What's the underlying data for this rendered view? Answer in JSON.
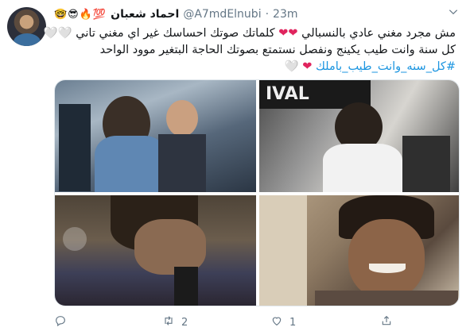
{
  "tweet": {
    "emojis": "🤓😎🔥💯",
    "name": "احماد شعبان",
    "handle": "@A7mdElnubi",
    "dot": "·",
    "time": "23m",
    "lines": [
      {
        "before": "مش مجرد مغني عادي بالنسبالي ",
        "hearts": "❤❤",
        "after": " كلماتك صوتك احساسك غير اي مغني تاني ",
        "white_hearts": "🤍🤍"
      },
      {
        "before": "كل سنة وانت طيب يكينج ونفصل نستمتع بصوتك الحاجة البتغير موود الواحد ",
        "hearts": "",
        "after": "",
        "white_hearts": ""
      },
      {
        "hashtag": "#كل_سنه_وانت_طيب_باملك",
        "hearts": " ❤",
        "white_hearts": "🤍"
      }
    ],
    "actions": {
      "reply_count": "",
      "retweet_count": "2",
      "like_count": "1"
    },
    "icons": {
      "reply": "reply-icon",
      "retweet": "retweet-icon",
      "like": "like-icon",
      "share": "share-icon",
      "more": "chevron-down-icon"
    },
    "colors": {
      "link": "#1b95e0",
      "secondary": "#657786",
      "heart": "#e0245e"
    }
  }
}
